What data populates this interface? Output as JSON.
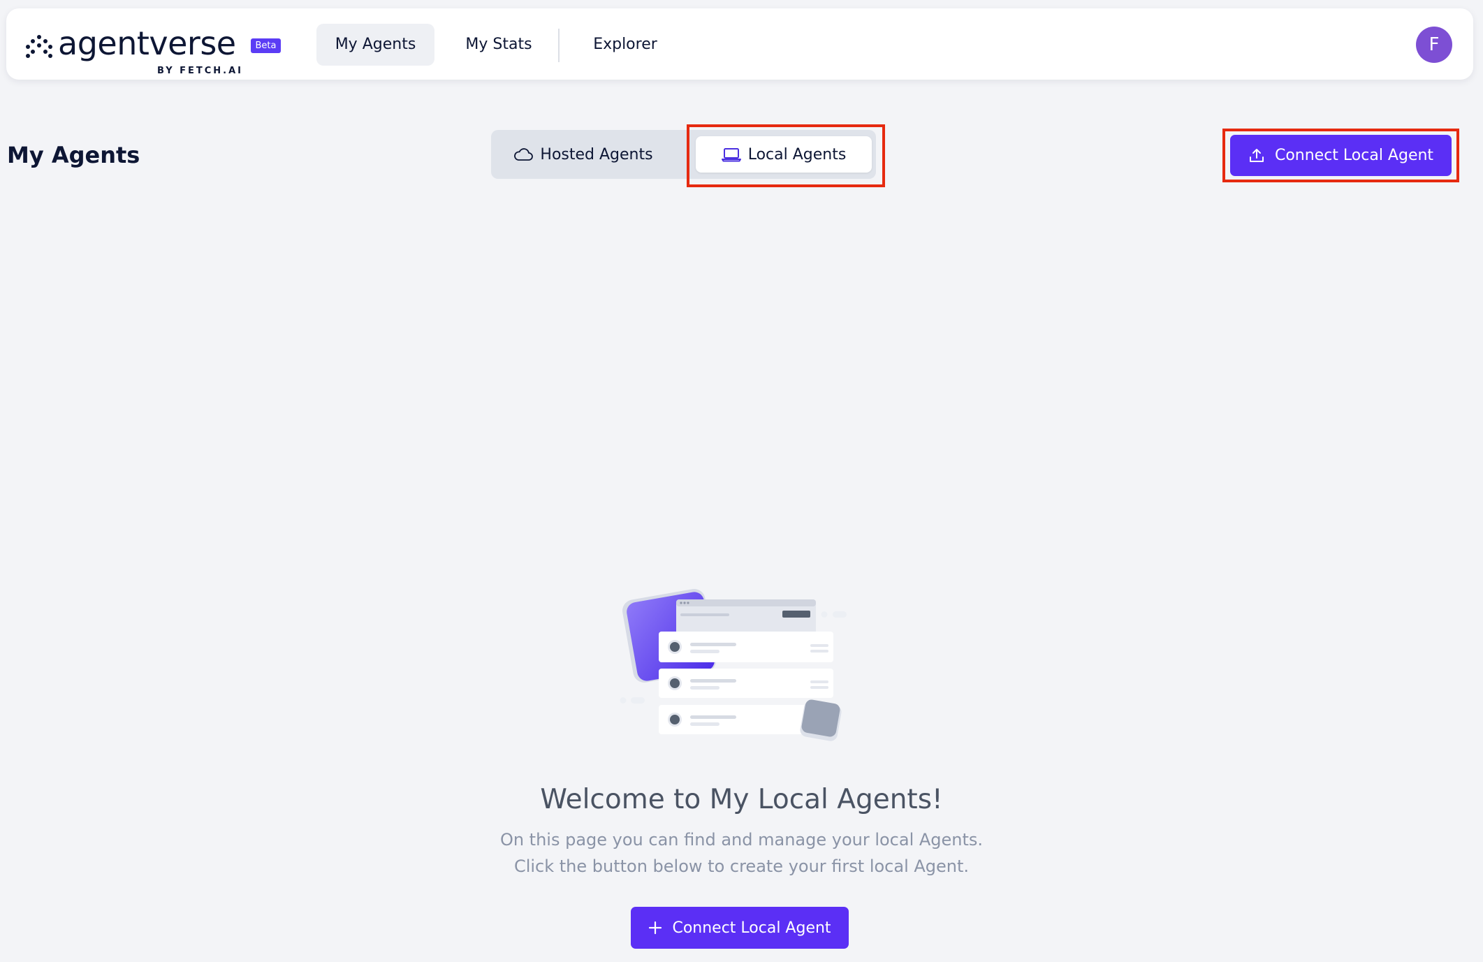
{
  "brand": {
    "name": "agentverse",
    "badge": "Beta",
    "byline": "BY FETCH.AI"
  },
  "nav": {
    "items": [
      {
        "label": "My Agents",
        "active": true
      },
      {
        "label": "My Stats",
        "active": false
      },
      {
        "label": "Explorer",
        "active": false
      }
    ],
    "avatar_initial": "F"
  },
  "page": {
    "title": "My Agents",
    "tabs": [
      {
        "label": "Hosted Agents",
        "icon": "cloud-icon",
        "selected": false
      },
      {
        "label": "Local Agents",
        "icon": "laptop-icon",
        "selected": true
      }
    ],
    "connect_button_label": "Connect Local Agent"
  },
  "empty_state": {
    "title": "Welcome to My Local Agents!",
    "line1": "On this page you can find and manage your local Agents.",
    "line2": "Click the button below to create your first local Agent.",
    "button_label": "Connect Local Agent"
  },
  "colors": {
    "accent": "#5b2ff5",
    "highlight_box": "#e62a10",
    "background": "#f3f4f7"
  }
}
